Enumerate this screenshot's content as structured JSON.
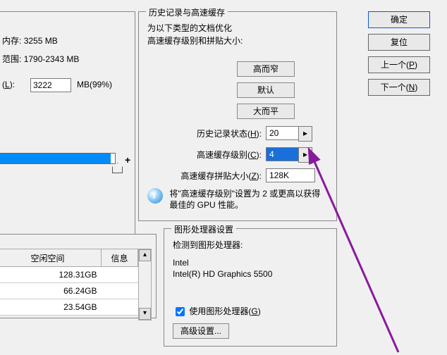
{
  "memory": {
    "mem_label": "内存:",
    "mem_value": "3255 MB",
    "range_label": "范围:",
    "range_value": "1790-2343 MB",
    "use_label_pre": "(",
    "use_hotkey": "L",
    "use_label_post": "):",
    "use_value": "3222",
    "use_suffix": "MB(99%)",
    "plus": "+"
  },
  "disk": {
    "col_space": "空闲空间",
    "col_info": "信息",
    "rows": [
      {
        "space": "128.31GB",
        "info": ""
      },
      {
        "space": "66.24GB",
        "info": ""
      },
      {
        "space": "23.54GB",
        "info": ""
      }
    ]
  },
  "history": {
    "panel_title": "历史记录与高速缓存",
    "desc1": "为以下类型的文档优化",
    "desc2": "高速缓存级别和拼贴大小:",
    "btn_tall": "高而窄",
    "btn_default": "默认",
    "btn_wide": "大而平",
    "hist_state_label_pre": "历史记录状态(",
    "hist_state_hot": "H",
    "hist_state_label_post": "):",
    "hist_state_value": "20",
    "cache_level_label_pre": "高速缓存级别(",
    "cache_level_hot": "C",
    "cache_level_label_post": "):",
    "cache_level_value": "4",
    "tile_label_pre": "高速缓存拼贴大小(",
    "tile_hot": "Z",
    "tile_label_post": "):",
    "tile_value": "128K",
    "hint": "将\"高速缓存级别\"设置为 2 或更高以获得最佳的 GPU 性能。",
    "step_glyph": "▸"
  },
  "gpu": {
    "panel_title": "图形处理器设置",
    "detect_label": "检测到图形处理器:",
    "gpu_name": "Intel\nIntel(R) HD Graphics 5500",
    "use_gpu_label_pre": "使用图形处理器(",
    "use_gpu_hot": "G",
    "use_gpu_label_post": ")",
    "use_gpu_checked": true,
    "adv_label": "高级设置..."
  },
  "right": {
    "ok": "确定",
    "reset": "复位",
    "prev_pre": "上一个(",
    "prev_hot": "P",
    "prev_post": ")",
    "next_pre": "下一个(",
    "next_hot": "N",
    "next_post": ")"
  }
}
